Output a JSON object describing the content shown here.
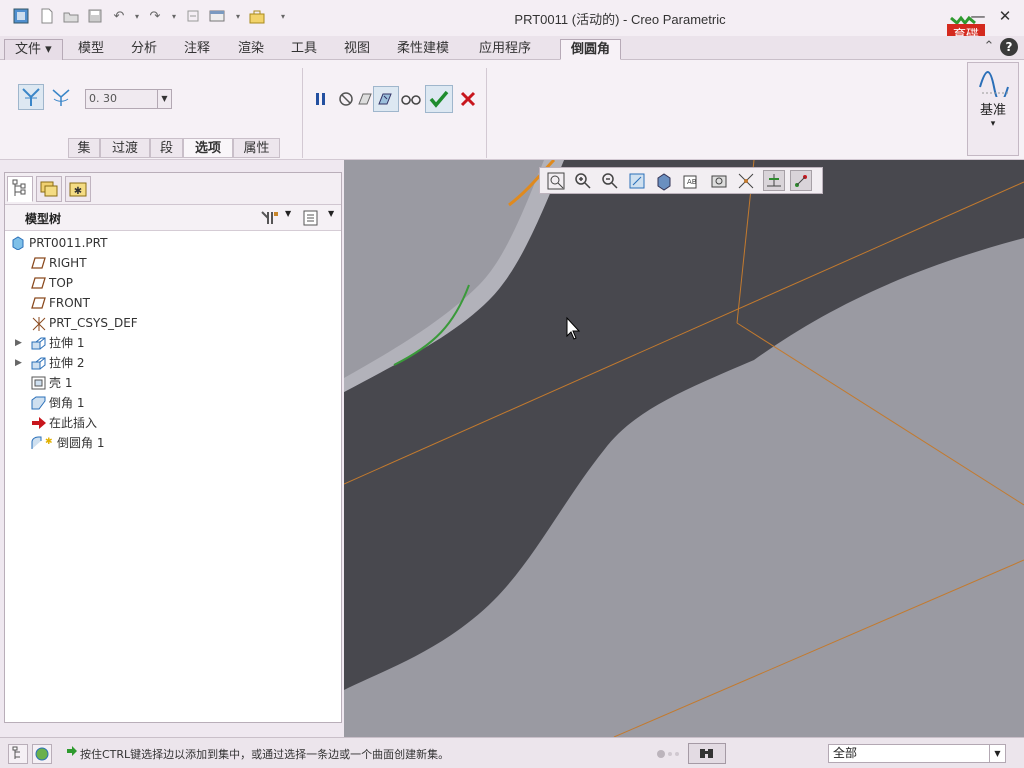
{
  "window": {
    "title": "PRT0011 (活动的) - Creo Parametric",
    "minimize": "—",
    "close": "✕",
    "help": "?"
  },
  "watermark": "育碟软件",
  "tabs": [
    {
      "label": "文件 ▾"
    },
    {
      "label": "模型"
    },
    {
      "label": "分析"
    },
    {
      "label": "注释"
    },
    {
      "label": "渲染"
    },
    {
      "label": "工具"
    },
    {
      "label": "视图"
    },
    {
      "label": "柔性建模"
    },
    {
      "label": "应用程序"
    },
    {
      "label": "倒圆角"
    }
  ],
  "ribbon": {
    "radius_value": "0. 30",
    "subtabs": [
      "集",
      "过渡",
      "段",
      "选项",
      "属性"
    ],
    "active_subtab": "选项",
    "datum_label": "基准",
    "datum_arrow": "▾"
  },
  "left_panel": {
    "model_tree_title": "模型树",
    "tree": [
      {
        "label": "PRT0011.PRT",
        "icon": "part-icon",
        "expandable": false
      },
      {
        "label": "RIGHT",
        "icon": "datum-plane-icon",
        "expandable": false
      },
      {
        "label": "TOP",
        "icon": "datum-plane-icon",
        "expandable": false
      },
      {
        "label": "FRONT",
        "icon": "datum-plane-icon",
        "expandable": false
      },
      {
        "label": "PRT_CSYS_DEF",
        "icon": "csys-icon",
        "expandable": false
      },
      {
        "label": "拉伸 1",
        "icon": "extrude-icon",
        "expandable": true
      },
      {
        "label": "拉伸 2",
        "icon": "extrude-icon",
        "expandable": true
      },
      {
        "label": "壳 1",
        "icon": "shell-icon",
        "expandable": false
      },
      {
        "label": "倒角 1",
        "icon": "chamfer-icon",
        "expandable": false
      },
      {
        "label": "在此插入",
        "icon": "insert-here-icon",
        "expandable": false
      },
      {
        "label": "倒圆角 1",
        "icon": "round-icon",
        "expandable": false
      }
    ]
  },
  "status": {
    "message": "按住CTRL键选择边以添加到集中，或通过选择一条边或一个曲面创建新集。",
    "filter_value": "全部"
  },
  "colors": {
    "accent_orange": "#e08a1e",
    "accent_green": "#3a9a3a",
    "confirm_green": "#1e8c2e",
    "cancel_red": "#c8161d",
    "viewport_dark": "#48484e",
    "viewport_light": "#9a9aa2"
  }
}
